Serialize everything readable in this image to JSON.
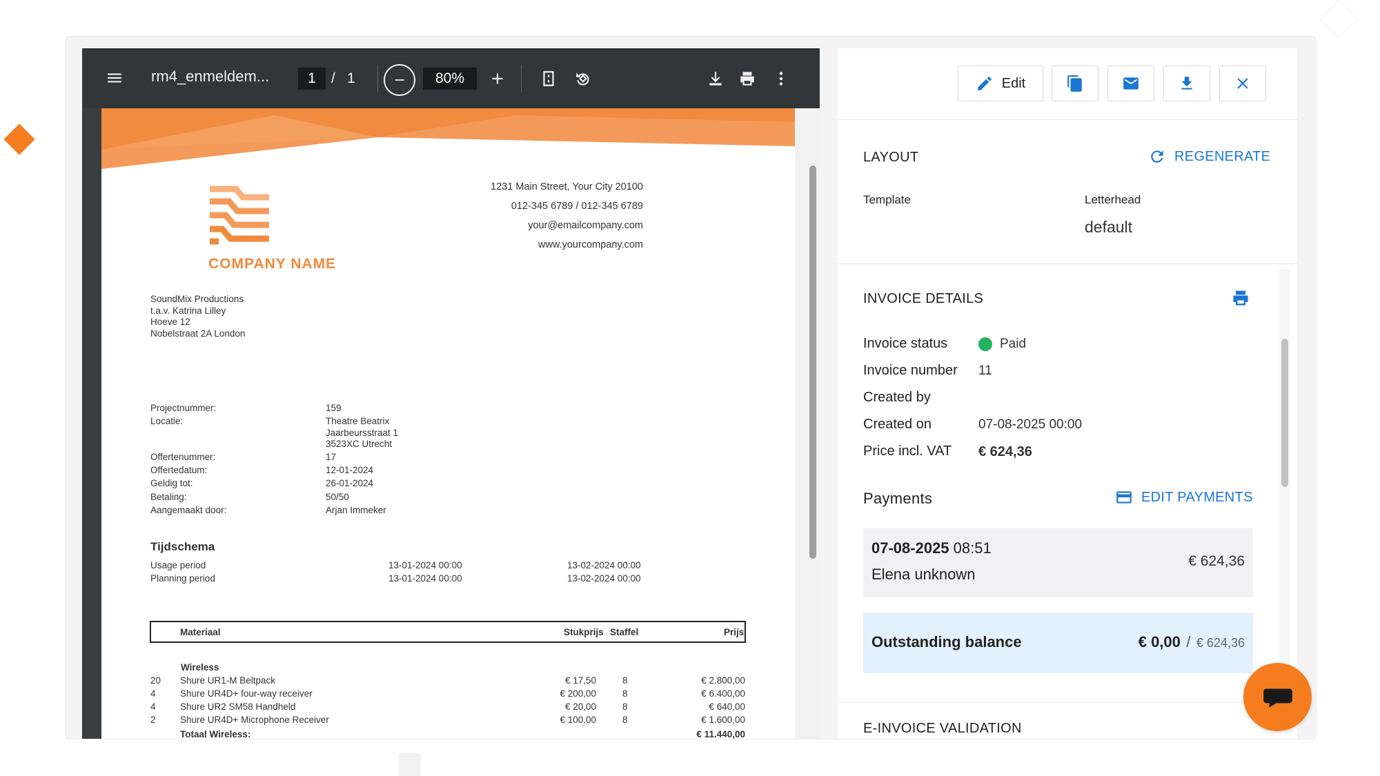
{
  "pdf_viewer": {
    "file_name": "rm4_enmeldem...",
    "current_page": "1",
    "page_separator": "/",
    "total_pages": "1",
    "zoom": "80%"
  },
  "invoice_document": {
    "company_name": "COMPANY NAME",
    "company_address": [
      "1231 Main Street, Your City 20100",
      "012-345 6789 / 012-345 6789",
      "your@emailcompany.com",
      "www.yourcompany.com"
    ],
    "recipient": [
      "SoundMix Productions",
      "t.a.v. Katrina Lilley",
      "Hoeve 12",
      "Nobelstraat 2A London"
    ],
    "details": [
      {
        "label": "Projectnummer:",
        "value": "159"
      },
      {
        "label": "Locatie:",
        "value": "Theatre Beatrix"
      },
      {
        "label": "",
        "value": "Jaarbeursstraat 1"
      },
      {
        "label": "",
        "value": "3523XC Utrecht"
      },
      {
        "label": "Offertenummer:",
        "value": "17"
      },
      {
        "label": "Offertedatum:",
        "value": "12-01-2024"
      },
      {
        "label": "Geldig tot:",
        "value": "26-01-2024"
      },
      {
        "label": "Betaling:",
        "value": "50/50"
      },
      {
        "label": "Aangemaakt door:",
        "value": "Arjan Immeker"
      }
    ],
    "schedule_title": "Tijdschema",
    "schedule": [
      {
        "label": "Usage period",
        "start": "13-01-2024 00:00",
        "end": "13-02-2024 00:00"
      },
      {
        "label": "Planning period",
        "start": "13-01-2024 00:00",
        "end": "13-02-2024 00:00"
      }
    ],
    "table_headers": {
      "material": "Materiaal",
      "unit_price": "Stukprijs",
      "tier": "Staffel",
      "price": "Prijs"
    },
    "group_name": "Wireless",
    "items": [
      {
        "qty": "20",
        "name": "Shure UR1-M Beltpack",
        "unit_price": "€ 17,50",
        "tier": "8",
        "price": "€ 2.800,00"
      },
      {
        "qty": "4",
        "name": "Shure UR4D+ four-way receiver",
        "unit_price": "€ 200,00",
        "tier": "8",
        "price": "€ 6.400,00"
      },
      {
        "qty": "4",
        "name": "Shure UR2 SM58 Handheld",
        "unit_price": "€ 20,00",
        "tier": "8",
        "price": "€ 640,00"
      },
      {
        "qty": "2",
        "name": "Shure UR4D+ Microphone Receiver",
        "unit_price": "€ 100,00",
        "tier": "8",
        "price": "€ 1.600,00"
      }
    ],
    "total_label": "Totaal Wireless:",
    "total_value": "€ 11.440,00"
  },
  "panel": {
    "toolbar": {
      "edit_label": "Edit"
    },
    "layout": {
      "title": "LAYOUT",
      "regenerate_label": "REGENERATE",
      "template_label": "Template",
      "letterhead_label": "Letterhead",
      "letterhead_value": "default"
    },
    "invoice_details": {
      "title": "INVOICE DETAILS",
      "rows": [
        {
          "label": "Invoice status",
          "value": "Paid"
        },
        {
          "label": "Invoice number",
          "value": "11"
        },
        {
          "label": "Created by",
          "value": ""
        },
        {
          "label": "Created on",
          "value": "07-08-2025 00:00"
        },
        {
          "label": "Price incl. VAT",
          "value": "€ 624,36"
        }
      ],
      "status_color": "#22b35e"
    },
    "payments": {
      "title": "Payments",
      "edit_label": "EDIT PAYMENTS",
      "entry": {
        "date": "07-08-2025",
        "time": "08:51",
        "person": "Elena unknown",
        "amount": "€ 624,36"
      },
      "balance_label": "Outstanding balance",
      "balance_value": "€ 0,00",
      "balance_separator": "/",
      "balance_total": "€ 624,36"
    },
    "einvoice": {
      "title": "E-INVOICE VALIDATION"
    }
  },
  "colors": {
    "accent": "#1976d2",
    "brand_orange": "#f57c1f",
    "paid_green": "#22b35e"
  }
}
